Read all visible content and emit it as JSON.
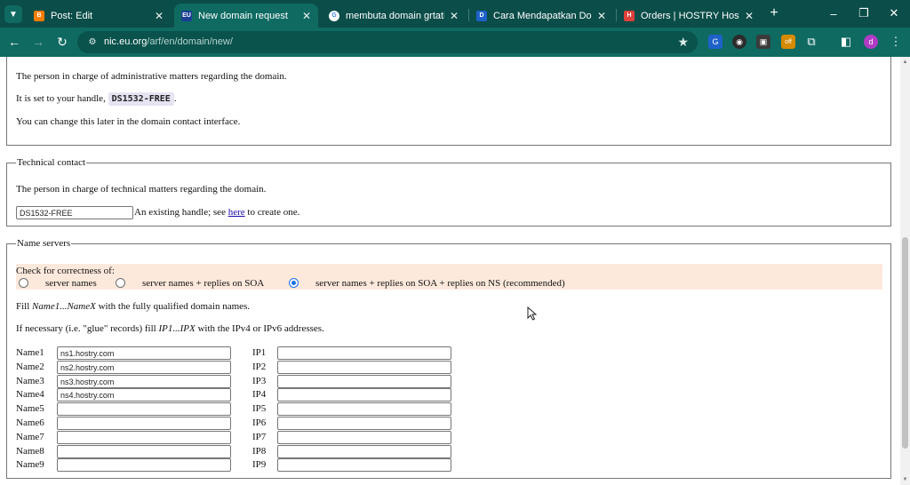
{
  "browser": {
    "tabs": [
      {
        "title": "Post: Edit",
        "icon": "blogger-icon",
        "color": "#f57d00",
        "glyph": "B"
      },
      {
        "title": "New domain request",
        "icon": "eu-flag-icon",
        "color": "#1c3f94",
        "glyph": "EU",
        "active": true
      },
      {
        "title": "membuta domain grtatis di",
        "icon": "google-icon",
        "color": "#ffffff",
        "glyph": "G"
      },
      {
        "title": "Cara Mendapatkan Domain",
        "icon": "doc-icon",
        "color": "#1e62c9",
        "glyph": "D"
      },
      {
        "title": "Orders | HOSTRY Hosting Se",
        "icon": "hostry-icon",
        "color": "#e0403a",
        "glyph": "H"
      }
    ],
    "url_host": "nic.eu.org",
    "url_path": "/arf/en/domain/new/",
    "profile_initial": "d",
    "ext_badge": "off"
  },
  "admin": {
    "desc": "The person in charge of administrative matters regarding the domain.",
    "handle_prefix": "It is set to your handle,",
    "handle": "DS1532-FREE",
    "handle_suffix": ".",
    "change_note": "You can change this later in the domain contact interface."
  },
  "tech": {
    "legend": "Technical contact",
    "desc": "The person in charge of technical matters regarding the domain.",
    "handle_value": "DS1532-FREE",
    "hint_prefix": "An existing handle; see",
    "hint_link": "here",
    "hint_suffix": "to create one."
  },
  "ns": {
    "legend": "Name servers",
    "check_label": "Check for correctness of:",
    "options": [
      "server names",
      "server names + replies on SOA",
      "server names + replies on SOA + replies on NS (recommended)"
    ],
    "fill_prefix": "Fill",
    "fill_em": "Name1...NameX",
    "fill_suffix": "with the fully qualified domain names.",
    "glue_prefix": "If necessary (i.e. \"glue\" records) fill",
    "glue_em": "IP1...IPX",
    "glue_suffix": "with the IPv4 or IPv6 addresses.",
    "rows": [
      {
        "name_label": "Name1",
        "name_value": "ns1.hostry.com",
        "ip_label": "IP1",
        "ip_value": ""
      },
      {
        "name_label": "Name2",
        "name_value": "ns2.hostry.com",
        "ip_label": "IP2",
        "ip_value": ""
      },
      {
        "name_label": "Name3",
        "name_value": "ns3.hostry.com",
        "ip_label": "IP3",
        "ip_value": ""
      },
      {
        "name_label": "Name4",
        "name_value": "ns4.hostry.com",
        "ip_label": "IP4",
        "ip_value": ""
      },
      {
        "name_label": "Name5",
        "name_value": "",
        "ip_label": "IP5",
        "ip_value": ""
      },
      {
        "name_label": "Name6",
        "name_value": "",
        "ip_label": "IP6",
        "ip_value": ""
      },
      {
        "name_label": "Name7",
        "name_value": "",
        "ip_label": "IP7",
        "ip_value": ""
      },
      {
        "name_label": "Name8",
        "name_value": "",
        "ip_label": "IP8",
        "ip_value": ""
      },
      {
        "name_label": "Name9",
        "name_value": "",
        "ip_label": "IP9",
        "ip_value": ""
      }
    ]
  },
  "colors": {
    "chrome_dark": "#0b4d48",
    "chrome": "#0f6a62",
    "check_band": "#fde9dc",
    "accent": "#1a73e8"
  }
}
